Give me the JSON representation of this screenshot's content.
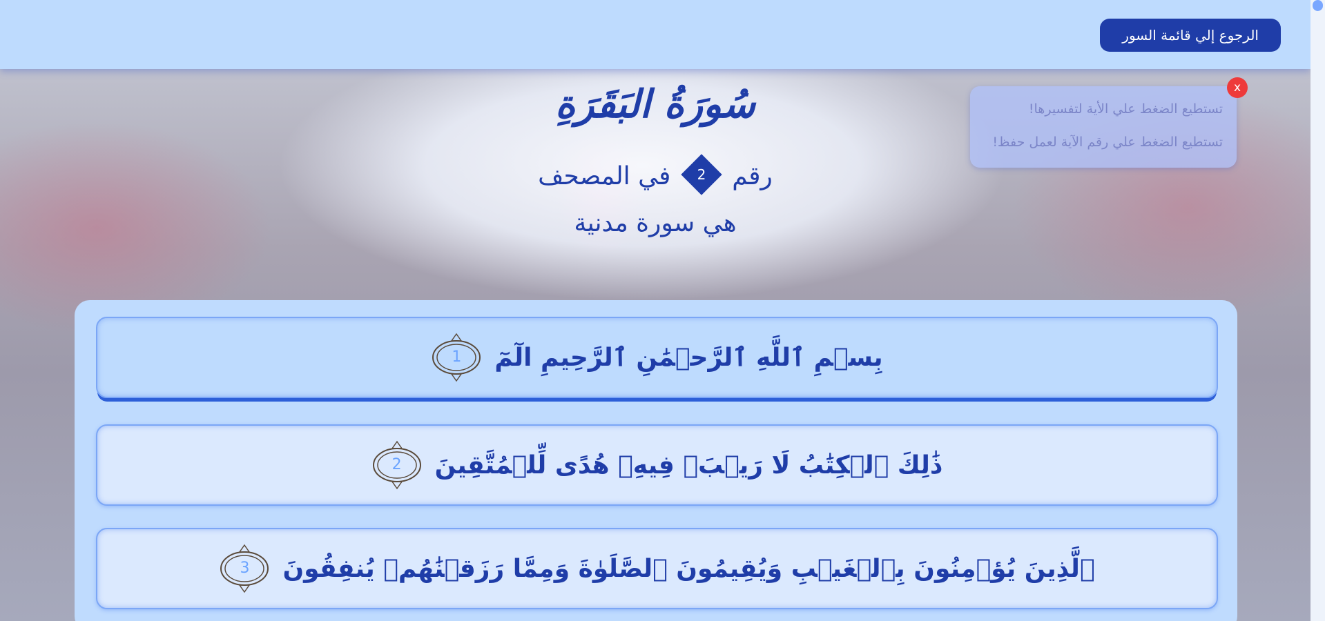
{
  "topbar": {
    "back_label": "الرجوع إلي قائمة السور"
  },
  "surah": {
    "title": "سُورَةُ البَقَرَةِ",
    "number_prefix": "رقم",
    "number": "2",
    "number_suffix": "في المصحف",
    "type_text": "هي سورة مدنية"
  },
  "tips": {
    "close_label": "x",
    "items": [
      "تستطيع الضغط علي الأية لتفسيرها!",
      "تستطيع الضغط علي رقم الآية لعمل حفظ!"
    ]
  },
  "verses": [
    {
      "number": "1",
      "text": "بِسۡمِ ٱللَّهِ ٱلرَّحۡمَٰنِ ٱلرَّحِيمِ الٓمٓ"
    },
    {
      "number": "2",
      "text": "ذَٰلِكَ ٱلۡكِتَٰبُ لَا رَيۡبَۛ فِيهِۛ هُدًى لِّلۡمُتَّقِينَ"
    },
    {
      "number": "3",
      "text": "ٱلَّذِينَ يُؤۡمِنُونَ بِٱلۡغَيۡبِ وَيُقِيمُونَ ٱلصَّلَوٰةَ وَمِمَّا رَزَقۡنَٰهُمۡ يُنفِقُونَ"
    }
  ],
  "colors": {
    "accent": "#1f3da8",
    "topbar_bg": "#bedbfe",
    "close_red": "#ee3a3a",
    "verse_number": "#6aa3ff"
  }
}
